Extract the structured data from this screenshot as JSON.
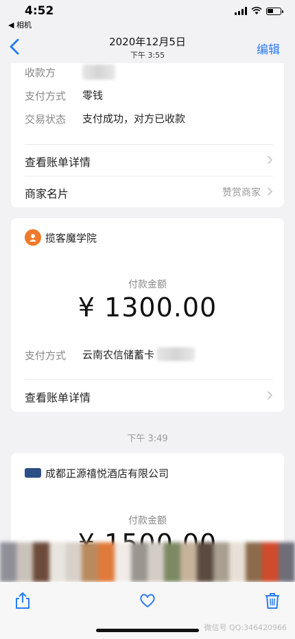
{
  "status_bar": {
    "time": "4:52",
    "back_app": "◀ 相机"
  },
  "nav": {
    "title": "2020年12月5日",
    "subtitle": "下午 3:55",
    "edit": "编辑"
  },
  "card1": {
    "rows": [
      {
        "label": "收款方",
        "value": ""
      },
      {
        "label": "支付方式",
        "value": "零钱"
      },
      {
        "label": "交易状态",
        "value": "支付成功，对方已收款"
      }
    ],
    "bill_detail": "查看账单详情",
    "merchant_card": "商家名片",
    "reward_merchant": "赞赏商家"
  },
  "card2": {
    "merchant": "揽客魔学院",
    "amount_label": "付款金额",
    "amount": "¥ 1300.00",
    "payment_method_label": "支付方式",
    "payment_method_value": "云南农信储蓄卡",
    "bill_detail": "查看账单详情"
  },
  "timestamp2": "下午 3:49",
  "card3": {
    "merchant": "成都正源禧悦酒店有限公司",
    "amount_label": "付款金额",
    "amount": "¥ 1500.00"
  },
  "watermark": "微信号 QQ:346420966",
  "icons": {
    "share": "share-icon",
    "favorite": "heart-icon",
    "delete": "trash-icon",
    "back": "chevron-left-icon"
  },
  "colors": {
    "accent": "#2a7cf6",
    "merchant_orange": "#f07a2a",
    "merchant_blue": "#2c4f86"
  }
}
